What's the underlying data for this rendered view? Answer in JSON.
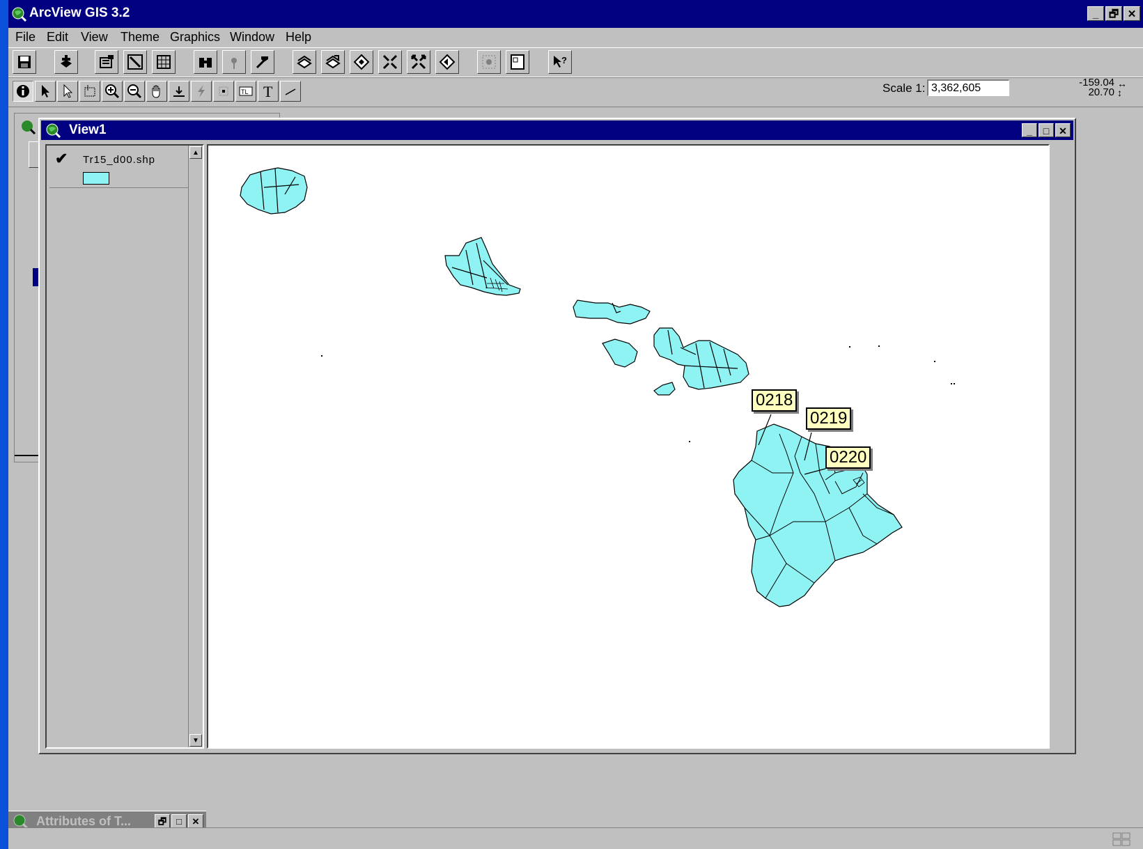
{
  "app": {
    "title": "ArcView GIS 3.2",
    "window_buttons": [
      "_",
      "🗗",
      "✕"
    ]
  },
  "menu": [
    {
      "label": "File"
    },
    {
      "label": "Edit"
    },
    {
      "label": "View"
    },
    {
      "label": "Theme"
    },
    {
      "label": "Graphics"
    },
    {
      "label": "Window"
    },
    {
      "label": "Help"
    }
  ],
  "button_bar": {
    "icons": [
      "save-project-icon",
      "add-theme-icon",
      "theme-properties-icon",
      "edit-legend-icon",
      "open-table-icon",
      "find-icon",
      "locate-address-icon",
      "query-builder-icon",
      "zoom-full-extent-icon",
      "zoom-active-themes-icon",
      "zoom-selected-icon",
      "zoom-in-fixed-icon",
      "zoom-out-fixed-icon",
      "zoom-previous-icon",
      "select-by-theme-icon",
      "layout-icon",
      "help-icon"
    ]
  },
  "tool_bar": {
    "icons": [
      "identify-icon",
      "pointer-icon",
      "vertex-edit-icon",
      "select-feature-icon",
      "zoom-in-icon",
      "zoom-out-icon",
      "pan-icon",
      "measure-icon",
      "hotlink-icon",
      "area-of-interest-icon",
      "label-icon",
      "text-icon",
      "draw-line-icon"
    ]
  },
  "scale": {
    "label": "Scale 1:",
    "value": "3,362,605"
  },
  "coordinates": {
    "x": "-159.04",
    "y": "20.70"
  },
  "view_window": {
    "title": "View1",
    "theme": {
      "name": "Tr15_d00.shp",
      "visible": true,
      "fill_color": "#8ff3f3"
    }
  },
  "map_labels": [
    "0218",
    "0219",
    "0220"
  ],
  "attributes_window": {
    "title": "Attributes of T..."
  },
  "colors": {
    "titlebar": "#000080",
    "desktop": "#0a50d8",
    "face": "#c0c0c0",
    "feature_fill": "#8ff3f3",
    "label_fill": "#ffffc0"
  }
}
